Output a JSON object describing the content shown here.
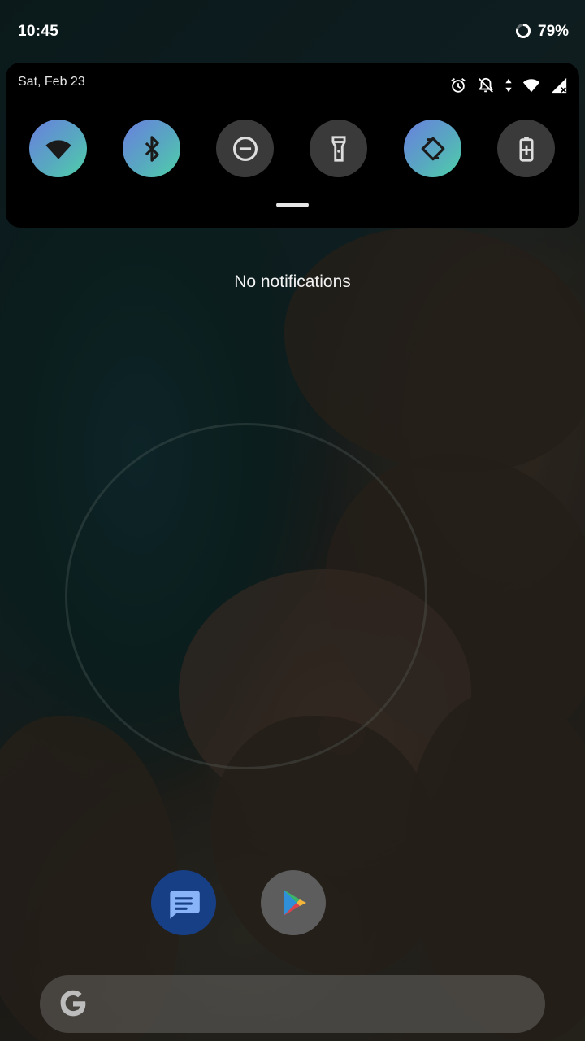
{
  "status_bar": {
    "time": "10:45",
    "battery_percent": "79%",
    "battery_level": 0.79
  },
  "quick_settings": {
    "date": "Sat, Feb 23",
    "status_icons": [
      "alarm-icon",
      "notifications-off-icon",
      "data-arrows-icon",
      "wifi-icon",
      "cell-signal-icon"
    ],
    "tiles": [
      {
        "name": "wifi",
        "icon": "wifi-icon",
        "state": "on"
      },
      {
        "name": "bluetooth",
        "icon": "bluetooth-icon",
        "state": "on"
      },
      {
        "name": "do-not-disturb",
        "icon": "do-not-disturb-icon",
        "state": "off"
      },
      {
        "name": "flashlight",
        "icon": "flashlight-icon",
        "state": "off"
      },
      {
        "name": "auto-rotate",
        "icon": "auto-rotate-icon",
        "state": "on"
      },
      {
        "name": "battery-saver",
        "icon": "battery-saver-icon",
        "state": "off"
      }
    ]
  },
  "notifications": {
    "empty_text": "No notifications"
  },
  "dock": {
    "apps": [
      {
        "name": "Messages",
        "icon": "messages-icon"
      },
      {
        "name": "Play Store",
        "icon": "play-store-icon"
      }
    ]
  },
  "search": {
    "logo": "google-g-icon"
  },
  "colors": {
    "tile_on_start": "#6a7fe0",
    "tile_on_end": "#4fd0a8",
    "tile_off": "#3a3a3a",
    "panel": "#000000"
  }
}
